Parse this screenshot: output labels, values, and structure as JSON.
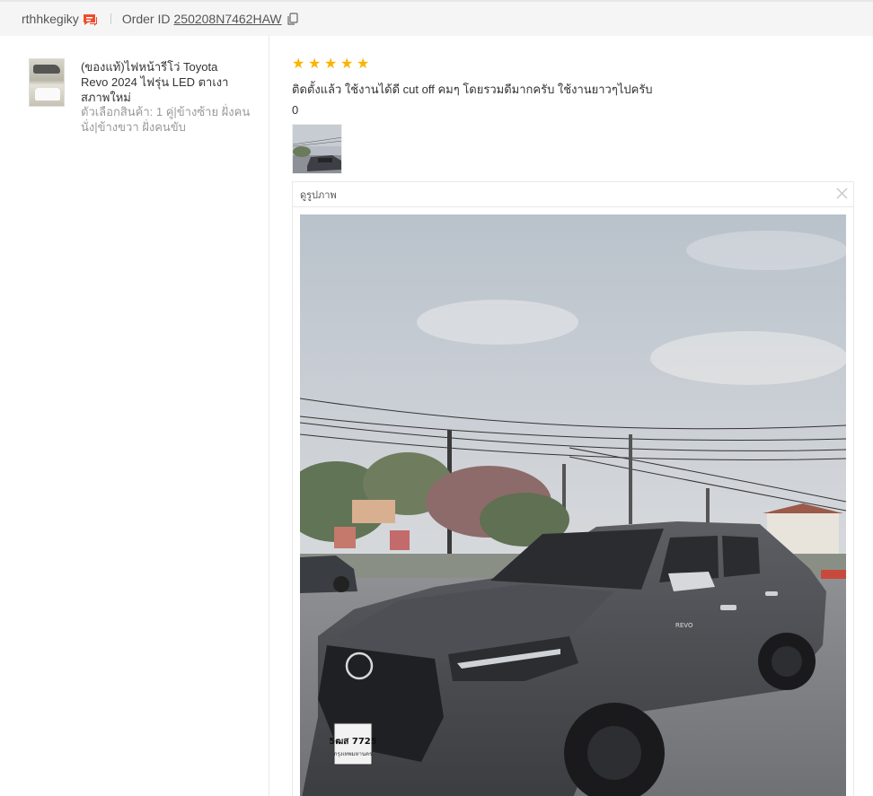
{
  "header": {
    "username": "rthhkegiky",
    "order_label": "Order ID",
    "order_id": "250208N7462HAW"
  },
  "product": {
    "title": "(ของแท้)ไฟหน้ารีโว่ Toyota Revo 2024 ไฟรุ่น LED ตาเงา สภาพใหม่",
    "variant": "ตัวเลือกสินค้า: 1 คู่|ข้างซ้าย ฝั่งคนนั่ง|ข้างขวา ฝั่งคนขับ"
  },
  "review": {
    "rating": 5,
    "text": "ติดตั้งแล้ว ใช้งานได้ดี cut off คมๆ โดยรวมดีมากครับ ใช้งานยาวๆไปครับ",
    "likes": "0"
  },
  "viewer": {
    "title": "ดูรูปภาพ"
  },
  "photo": {
    "plate_text": "5ฒส 7725",
    "plate_sub": "กรุงเทพมหานคร",
    "badge_text": "REVO"
  },
  "colors": {
    "accent": "#ee4d2d",
    "star": "#fcb400"
  }
}
